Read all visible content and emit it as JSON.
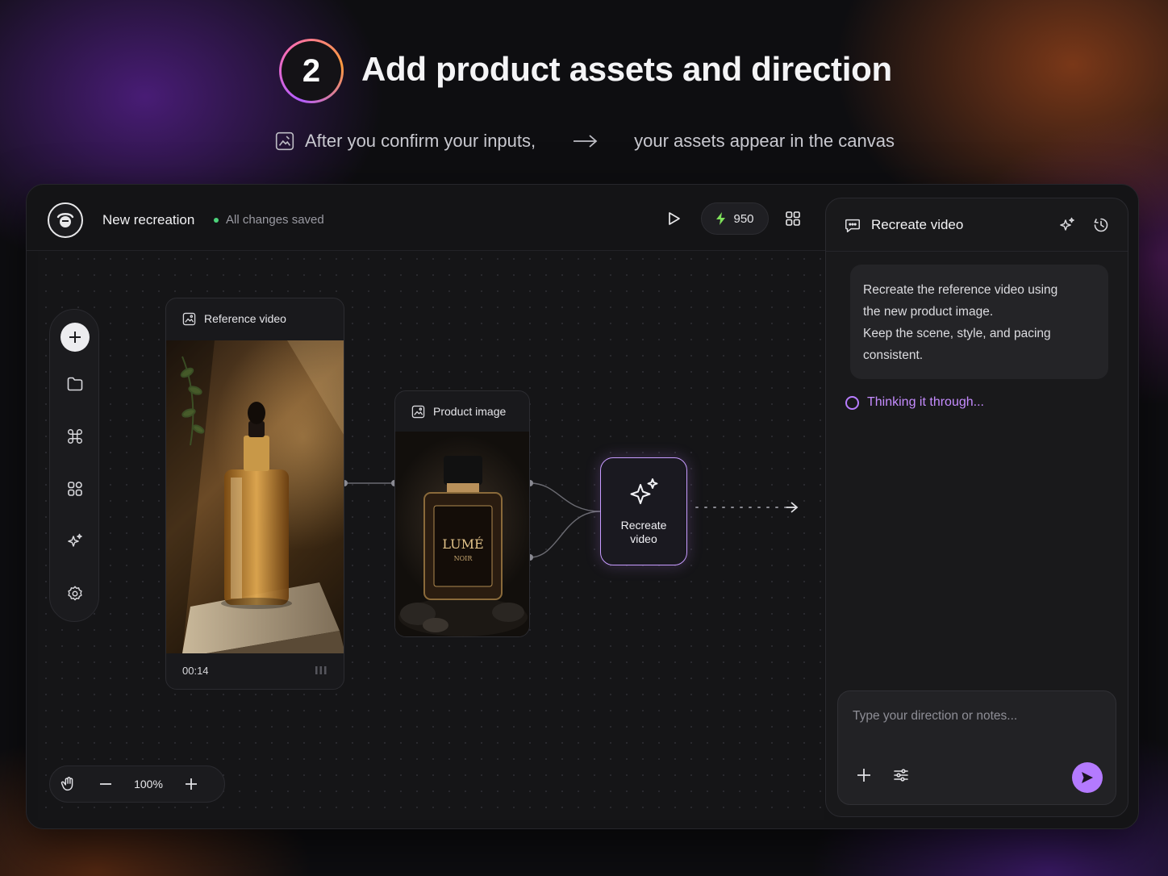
{
  "hero": {
    "step_number": "2",
    "title": "Add product assets and direction",
    "subtitle_left": "After you confirm your inputs,",
    "subtitle_right": "your assets appear in the canvas"
  },
  "topbar": {
    "project_name": "New recreation",
    "save_status": "All changes saved",
    "credits": "950",
    "icons": [
      "logo-icon",
      "play-icon",
      "bolt-icon",
      "grid-icon"
    ]
  },
  "rail": {
    "tools": [
      "add-icon",
      "folder-icon",
      "command-icon",
      "apps-icon",
      "sparkle-icon",
      "settings-icon"
    ]
  },
  "zoom": {
    "level": "100%"
  },
  "nodes": {
    "reference": {
      "label": "Reference video",
      "duration": "00:14"
    },
    "product": {
      "label": "Product image",
      "brand": "LUMÉ",
      "sub": "NOIR"
    },
    "recreate": {
      "line1": "Recreate",
      "line2": "video"
    }
  },
  "panel": {
    "title": "Recreate video",
    "message_line1": "Recreate the reference video using",
    "message_line2": "the new product image.",
    "message_line3": "Keep the scene, style, and pacing",
    "message_line4": "consistent.",
    "status": "Thinking it through...",
    "composer_placeholder": "Type your direction or notes..."
  },
  "colors": {
    "accent": "#b47aff",
    "status_dot": "#4cd37a",
    "credit_bolt": "#7ee05a"
  }
}
